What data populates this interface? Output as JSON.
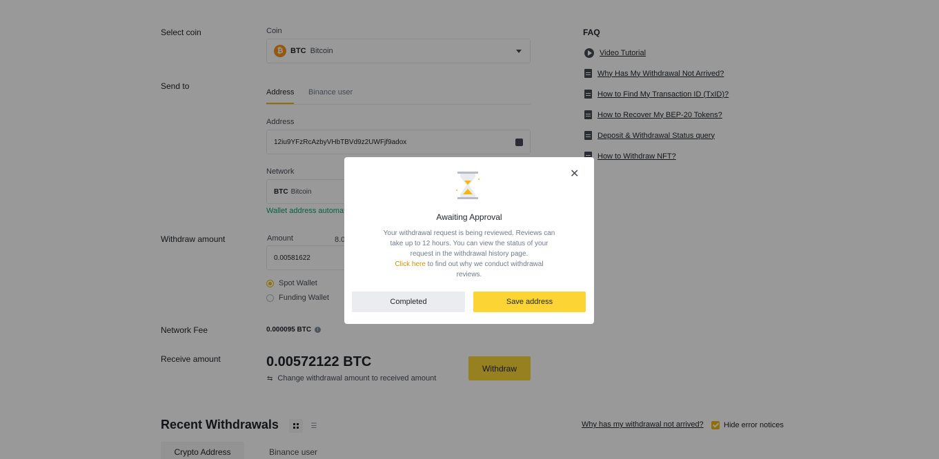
{
  "form": {
    "select_coin_label": "Select coin",
    "coin_field_label": "Coin",
    "coin_symbol": "BTC",
    "coin_name": "Bitcoin",
    "coin_icon_glyph": "₿",
    "send_to_label": "Send to",
    "tabs": [
      "Address",
      "Binance user"
    ],
    "address_label": "Address",
    "address_value": "12iu9YFzRcAzbyVHbTBVd9z2UWFjf9adox",
    "network_label": "Network",
    "network_symbol": "BTC",
    "network_name": "Bitcoin",
    "network_hint": "Wallet address automat",
    "withdraw_amount_label": "Withdraw amount",
    "amount_label": "Amount",
    "amount_partial": "8.0",
    "amount_value": "0.00581622",
    "wallets": [
      {
        "label": "Spot Wallet",
        "checked": true
      },
      {
        "label": "Funding Wallet",
        "checked": false
      }
    ],
    "network_fee_label": "Network Fee",
    "network_fee_value": "0.000095 BTC",
    "receive_amount_label": "Receive amount",
    "receive_amount_value": "0.00572122 BTC",
    "change_amount_text": "Change withdrawal amount to received amount",
    "withdraw_button": "Withdraw"
  },
  "faq": {
    "title": "FAQ",
    "items": [
      {
        "label": "Video Tutorial",
        "icon": "play-icon"
      },
      {
        "label": "Why Has My Withdrawal Not Arrived?",
        "icon": "document-icon"
      },
      {
        "label": "How to Find My Transaction ID (TxID)?",
        "icon": "document-icon"
      },
      {
        "label": "How to Recover My BEP-20 Tokens?",
        "icon": "document-icon"
      },
      {
        "label": "Deposit & Withdrawal Status query",
        "icon": "document-icon"
      },
      {
        "label": "How to Withdraw NFT?",
        "icon": "document-icon"
      }
    ]
  },
  "recent": {
    "title": "Recent Withdrawals",
    "not_arrived_link": "Why has my withdrawal not arrived?",
    "hide_error_label": "Hide error notices",
    "tabs": [
      "Crypto Address",
      "Binance user"
    ]
  },
  "modal": {
    "title": "Awaiting Approval",
    "body": "Your withdrawal request is being reviewed. Reviews can take up to 12 hours. You can view the status of your request in the withdrawal history page.",
    "link_text": "Click here",
    "link_suffix": " to find out why we conduct withdrawal reviews.",
    "completed_button": "Completed",
    "save_button": "Save address",
    "close_glyph": "✕"
  },
  "colors": {
    "accent": "#f0b90b",
    "button_yellow": "#fcd535",
    "success_green": "#03a66d",
    "overlay": "rgba(0,0,0,0.4)"
  }
}
